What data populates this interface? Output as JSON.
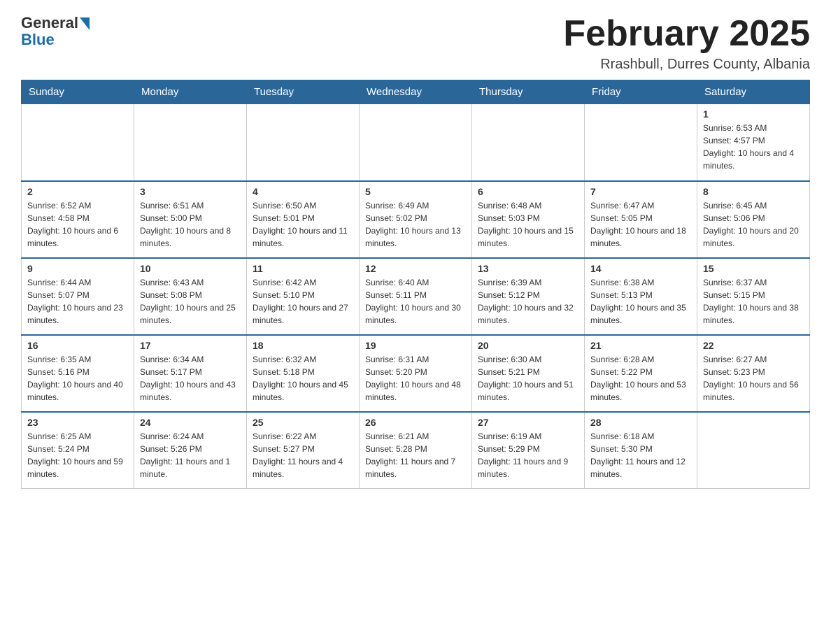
{
  "header": {
    "logo_general": "General",
    "logo_blue": "Blue",
    "month_title": "February 2025",
    "subtitle": "Rrashbull, Durres County, Albania"
  },
  "days_of_week": [
    "Sunday",
    "Monday",
    "Tuesday",
    "Wednesday",
    "Thursday",
    "Friday",
    "Saturday"
  ],
  "weeks": [
    [
      {
        "day": "",
        "info": ""
      },
      {
        "day": "",
        "info": ""
      },
      {
        "day": "",
        "info": ""
      },
      {
        "day": "",
        "info": ""
      },
      {
        "day": "",
        "info": ""
      },
      {
        "day": "",
        "info": ""
      },
      {
        "day": "1",
        "info": "Sunrise: 6:53 AM\nSunset: 4:57 PM\nDaylight: 10 hours and 4 minutes."
      }
    ],
    [
      {
        "day": "2",
        "info": "Sunrise: 6:52 AM\nSunset: 4:58 PM\nDaylight: 10 hours and 6 minutes."
      },
      {
        "day": "3",
        "info": "Sunrise: 6:51 AM\nSunset: 5:00 PM\nDaylight: 10 hours and 8 minutes."
      },
      {
        "day": "4",
        "info": "Sunrise: 6:50 AM\nSunset: 5:01 PM\nDaylight: 10 hours and 11 minutes."
      },
      {
        "day": "5",
        "info": "Sunrise: 6:49 AM\nSunset: 5:02 PM\nDaylight: 10 hours and 13 minutes."
      },
      {
        "day": "6",
        "info": "Sunrise: 6:48 AM\nSunset: 5:03 PM\nDaylight: 10 hours and 15 minutes."
      },
      {
        "day": "7",
        "info": "Sunrise: 6:47 AM\nSunset: 5:05 PM\nDaylight: 10 hours and 18 minutes."
      },
      {
        "day": "8",
        "info": "Sunrise: 6:45 AM\nSunset: 5:06 PM\nDaylight: 10 hours and 20 minutes."
      }
    ],
    [
      {
        "day": "9",
        "info": "Sunrise: 6:44 AM\nSunset: 5:07 PM\nDaylight: 10 hours and 23 minutes."
      },
      {
        "day": "10",
        "info": "Sunrise: 6:43 AM\nSunset: 5:08 PM\nDaylight: 10 hours and 25 minutes."
      },
      {
        "day": "11",
        "info": "Sunrise: 6:42 AM\nSunset: 5:10 PM\nDaylight: 10 hours and 27 minutes."
      },
      {
        "day": "12",
        "info": "Sunrise: 6:40 AM\nSunset: 5:11 PM\nDaylight: 10 hours and 30 minutes."
      },
      {
        "day": "13",
        "info": "Sunrise: 6:39 AM\nSunset: 5:12 PM\nDaylight: 10 hours and 32 minutes."
      },
      {
        "day": "14",
        "info": "Sunrise: 6:38 AM\nSunset: 5:13 PM\nDaylight: 10 hours and 35 minutes."
      },
      {
        "day": "15",
        "info": "Sunrise: 6:37 AM\nSunset: 5:15 PM\nDaylight: 10 hours and 38 minutes."
      }
    ],
    [
      {
        "day": "16",
        "info": "Sunrise: 6:35 AM\nSunset: 5:16 PM\nDaylight: 10 hours and 40 minutes."
      },
      {
        "day": "17",
        "info": "Sunrise: 6:34 AM\nSunset: 5:17 PM\nDaylight: 10 hours and 43 minutes."
      },
      {
        "day": "18",
        "info": "Sunrise: 6:32 AM\nSunset: 5:18 PM\nDaylight: 10 hours and 45 minutes."
      },
      {
        "day": "19",
        "info": "Sunrise: 6:31 AM\nSunset: 5:20 PM\nDaylight: 10 hours and 48 minutes."
      },
      {
        "day": "20",
        "info": "Sunrise: 6:30 AM\nSunset: 5:21 PM\nDaylight: 10 hours and 51 minutes."
      },
      {
        "day": "21",
        "info": "Sunrise: 6:28 AM\nSunset: 5:22 PM\nDaylight: 10 hours and 53 minutes."
      },
      {
        "day": "22",
        "info": "Sunrise: 6:27 AM\nSunset: 5:23 PM\nDaylight: 10 hours and 56 minutes."
      }
    ],
    [
      {
        "day": "23",
        "info": "Sunrise: 6:25 AM\nSunset: 5:24 PM\nDaylight: 10 hours and 59 minutes."
      },
      {
        "day": "24",
        "info": "Sunrise: 6:24 AM\nSunset: 5:26 PM\nDaylight: 11 hours and 1 minute."
      },
      {
        "day": "25",
        "info": "Sunrise: 6:22 AM\nSunset: 5:27 PM\nDaylight: 11 hours and 4 minutes."
      },
      {
        "day": "26",
        "info": "Sunrise: 6:21 AM\nSunset: 5:28 PM\nDaylight: 11 hours and 7 minutes."
      },
      {
        "day": "27",
        "info": "Sunrise: 6:19 AM\nSunset: 5:29 PM\nDaylight: 11 hours and 9 minutes."
      },
      {
        "day": "28",
        "info": "Sunrise: 6:18 AM\nSunset: 5:30 PM\nDaylight: 11 hours and 12 minutes."
      },
      {
        "day": "",
        "info": ""
      }
    ]
  ]
}
